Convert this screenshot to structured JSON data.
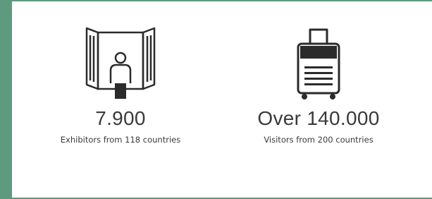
{
  "stats": [
    {
      "icon": "exhibitor-booth-icon",
      "value": "7.900",
      "caption": "Exhibitors from 118 countries"
    },
    {
      "icon": "suitcase-icon",
      "value": "Over 140.000",
      "caption": "Visitors from 200 countries"
    }
  ],
  "colors": {
    "frame": "#5e9a7d",
    "text": "#3a3a3a",
    "icon": "#2b2b2b"
  }
}
